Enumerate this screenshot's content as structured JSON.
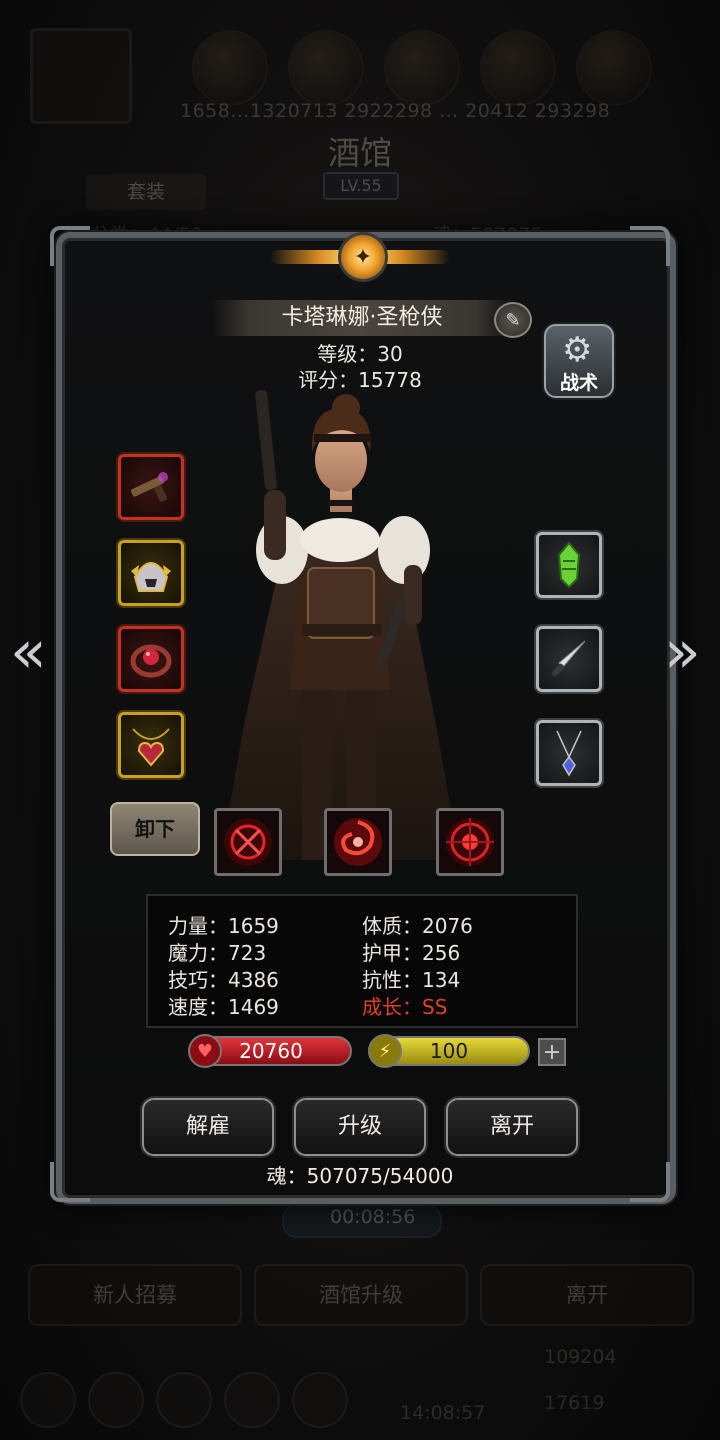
{
  "background": {
    "resources_text": "1658…1320713  2922298  …  20412  293298",
    "title": "酒馆",
    "level": "LV.55",
    "tab_label": "套装",
    "hero_count": "可分类：44/50",
    "soul_text": "魂：507075",
    "timer": "00:08:56",
    "buttons": [
      "新人招募",
      "酒馆升级",
      "离开"
    ],
    "gold": "109204",
    "gems": "17619",
    "clock": "14:08:57"
  },
  "hero": {
    "name": "卡塔琳娜·圣枪侠",
    "level_text": "等级：30",
    "score_text": "评分：15778",
    "tactics_label": "战术",
    "unequip_label": "卸下",
    "equipment_left": [
      {
        "name": "pistol-icon",
        "quality": "red"
      },
      {
        "name": "helmet-icon",
        "quality": "gold"
      },
      {
        "name": "ring-icon",
        "quality": "red"
      },
      {
        "name": "amulet-icon",
        "quality": "gold"
      }
    ],
    "equipment_right": [
      {
        "name": "green-gem-icon",
        "quality": "silver"
      },
      {
        "name": "dagger-icon",
        "quality": "silver"
      },
      {
        "name": "necklace-icon",
        "quality": "silver"
      }
    ],
    "skills": [
      "crosshair-skill-icon",
      "vortex-skill-icon",
      "target-skill-icon"
    ]
  },
  "attributes": {
    "strength": "力量：1659",
    "magic": "魔力：723",
    "skill": "技巧：4386",
    "speed": "速度：1469",
    "constitution": "体质：2076",
    "armor": "护甲：256",
    "resistance": "抗性：134",
    "growth": "成长：SS"
  },
  "bars": {
    "hp": "20760",
    "energy": "100"
  },
  "actions": {
    "dismiss": "解雇",
    "upgrade": "升级",
    "leave": "离开"
  },
  "soul_footer": "魂：507075/54000",
  "colors": {
    "growth": "#e04226",
    "hp": "#c81e26",
    "energy": "#d8c92a",
    "slot_red": "#c3331f",
    "slot_gold": "#c9a020",
    "slot_silver": "#b0b4b8"
  }
}
